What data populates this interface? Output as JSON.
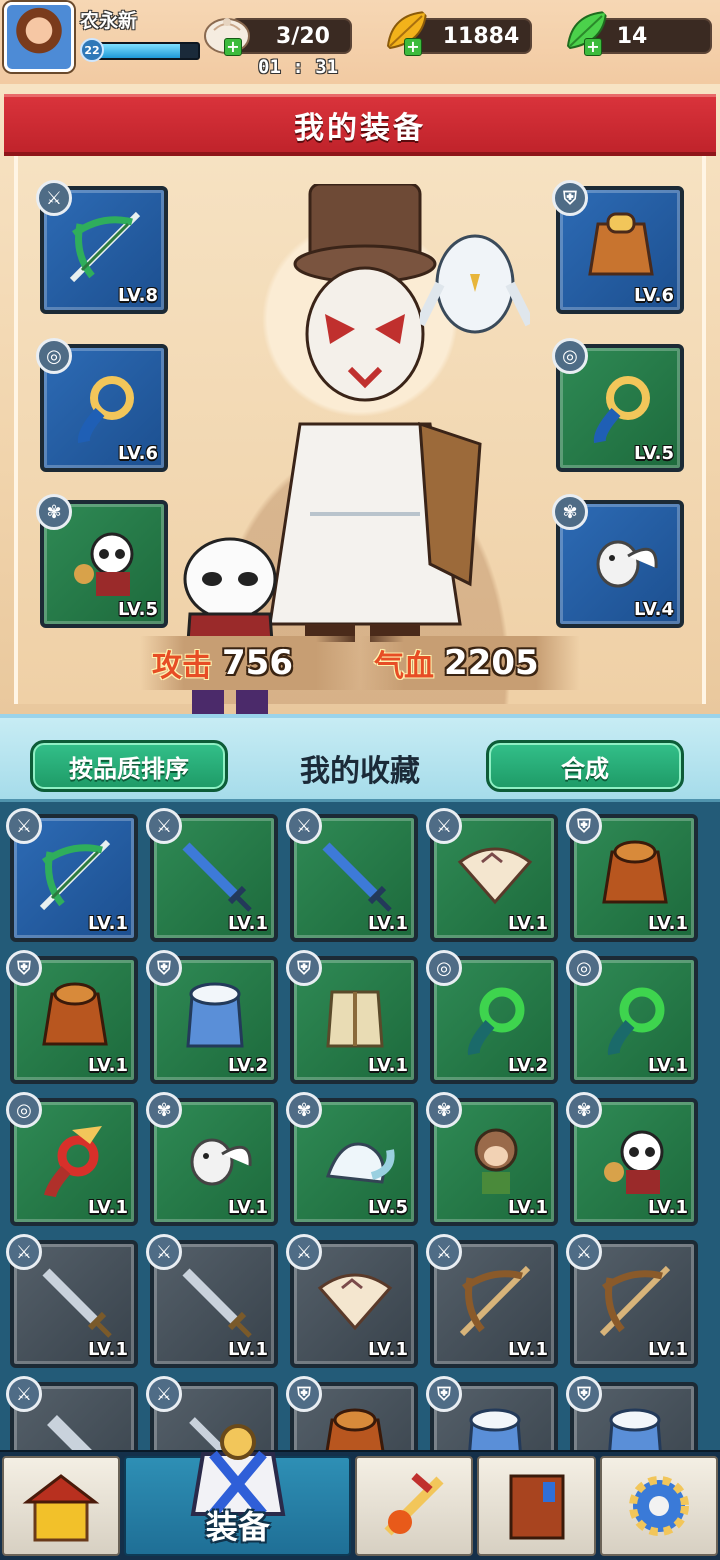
{
  "player": {
    "name": "农永新",
    "level": "22",
    "exp_fraction": 0.82
  },
  "resources": {
    "stamina": "3/20",
    "stamina_timer": "01 : 31",
    "gold": "11884",
    "leaf": "14",
    "plus": "+"
  },
  "equipment": {
    "title": "我的装备",
    "slots": [
      {
        "type_icon": "sword-icon",
        "item": "crossbow-icon",
        "level": "LV.8",
        "color": "blue"
      },
      {
        "type_icon": "armor-icon",
        "item": "armor-icon",
        "level": "LV.6",
        "color": "blue"
      },
      {
        "type_icon": "pendant-icon",
        "item": "jade-pendant-icon",
        "level": "LV.6",
        "color": "blue"
      },
      {
        "type_icon": "pendant-icon",
        "item": "jade-pendant-icon",
        "level": "LV.5",
        "color": "green"
      },
      {
        "type_icon": "paw-icon",
        "item": "panda-pet-icon",
        "level": "LV.5",
        "color": "green"
      },
      {
        "type_icon": "paw-icon",
        "item": "white-bird-pet-icon",
        "level": "LV.4",
        "color": "blue"
      }
    ],
    "stats": {
      "attack_label": "攻击",
      "attack_value": "756",
      "hp_label": "气血",
      "hp_value": "2205"
    }
  },
  "collection": {
    "sort_button": "按品质排序",
    "title": "我的收藏",
    "combine_button": "合成",
    "items": [
      {
        "type_icon": "sword-icon",
        "item": "crossbow-icon",
        "level": "LV.1",
        "color": "blue"
      },
      {
        "type_icon": "sword-icon",
        "item": "blue-sword-icon",
        "level": "LV.1",
        "color": "green"
      },
      {
        "type_icon": "sword-icon",
        "item": "blue-sword-icon",
        "level": "LV.1",
        "color": "green"
      },
      {
        "type_icon": "sword-icon",
        "item": "fan-icon",
        "level": "LV.1",
        "color": "green"
      },
      {
        "type_icon": "armor-icon",
        "item": "cape-armor-icon",
        "level": "LV.1",
        "color": "green"
      },
      {
        "type_icon": "armor-icon",
        "item": "cape-armor-icon",
        "level": "LV.1",
        "color": "green"
      },
      {
        "type_icon": "armor-icon",
        "item": "fur-robe-icon",
        "level": "LV.2",
        "color": "green"
      },
      {
        "type_icon": "armor-icon",
        "item": "robe-icon",
        "level": "LV.1",
        "color": "green"
      },
      {
        "type_icon": "pendant-icon",
        "item": "green-jade-pendant-icon",
        "level": "LV.2",
        "color": "green"
      },
      {
        "type_icon": "pendant-icon",
        "item": "green-jade-pendant-icon",
        "level": "LV.1",
        "color": "green"
      },
      {
        "type_icon": "pendant-icon",
        "item": "red-phoenix-pendant-icon",
        "level": "LV.1",
        "color": "green"
      },
      {
        "type_icon": "paw-icon",
        "item": "white-bird-pet-icon",
        "level": "LV.1",
        "color": "green"
      },
      {
        "type_icon": "paw-icon",
        "item": "ferret-pet-icon",
        "level": "LV.5",
        "color": "green"
      },
      {
        "type_icon": "paw-icon",
        "item": "monkey-pet-icon",
        "level": "LV.1",
        "color": "green"
      },
      {
        "type_icon": "paw-icon",
        "item": "panda-pet-icon",
        "level": "LV.1",
        "color": "green"
      },
      {
        "type_icon": "sword-icon",
        "item": "steel-sword-icon",
        "level": "LV.1",
        "color": "gray"
      },
      {
        "type_icon": "sword-icon",
        "item": "steel-sword-icon",
        "level": "LV.1",
        "color": "gray"
      },
      {
        "type_icon": "sword-icon",
        "item": "fan-icon",
        "level": "LV.1",
        "color": "gray"
      },
      {
        "type_icon": "sword-icon",
        "item": "wood-crossbow-icon",
        "level": "LV.1",
        "color": "gray"
      },
      {
        "type_icon": "sword-icon",
        "item": "wood-crossbow-icon",
        "level": "LV.1",
        "color": "gray"
      },
      {
        "type_icon": "sword-icon",
        "item": "dagger-icon",
        "level": "",
        "color": "gray"
      },
      {
        "type_icon": "sword-icon",
        "item": "blade-icon",
        "level": "",
        "color": "gray"
      },
      {
        "type_icon": "armor-icon",
        "item": "cape-armor-icon",
        "level": "",
        "color": "gray"
      },
      {
        "type_icon": "armor-icon",
        "item": "fur-robe-icon",
        "level": "",
        "color": "gray"
      },
      {
        "type_icon": "armor-icon",
        "item": "fur-robe-icon",
        "level": "",
        "color": "gray"
      }
    ]
  },
  "nav": {
    "items": [
      {
        "icon": "shop-icon",
        "label": ""
      },
      {
        "icon": "equipment-icon",
        "label": "装备",
        "active": true
      },
      {
        "icon": "weapon-forge-icon",
        "label": ""
      },
      {
        "icon": "book-icon",
        "label": ""
      },
      {
        "icon": "settings-gear-icon",
        "label": ""
      }
    ]
  },
  "colors": {
    "banner_red": "#c9262e",
    "slot_blue": "#2d6bb5",
    "slot_green": "#2f8a55",
    "slot_gray": "#55606a",
    "button_green": "#1e9a66",
    "nav_active": "#2e8fb5"
  }
}
